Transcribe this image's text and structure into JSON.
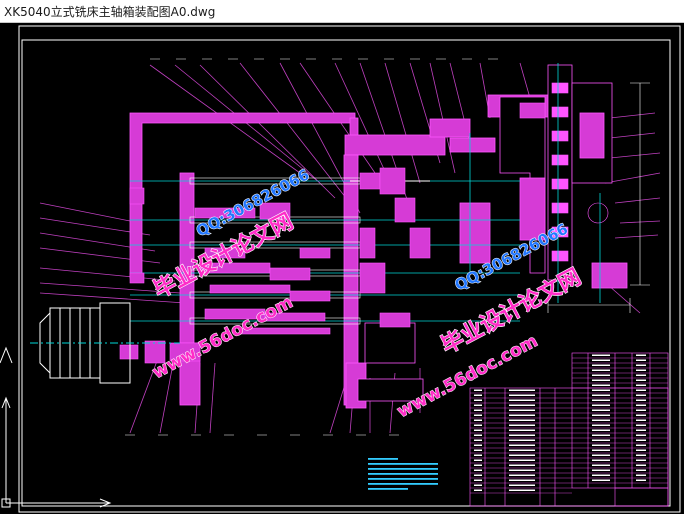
{
  "window": {
    "title": "XK5040立式铣床主轴箱装配图A0.dwg"
  },
  "watermarks": {
    "brand_1": "毕业设计论文网",
    "qq_1": "QQ:306826066",
    "site_1": "www.56doc.com",
    "site_2": "www.56doc.com",
    "brand_2": "毕业设计论文网",
    "qq_2": "QQ:306826066"
  },
  "colors": {
    "background": "#000000",
    "frame": "#ffffff",
    "part_fill": "#d63bd6",
    "part_line": "#ff55ff",
    "center_line": "#00d7d7",
    "leader_line": "#d040d0",
    "table_line": "#ff55ff",
    "table_text": "#ffffff",
    "note_text": "#33ccff",
    "watermark_pink": "#ff2cc8",
    "watermark_blue": "#2277ff",
    "watermark_outline": "#ffffff"
  },
  "icons": {
    "ucs": "ucs-axis-icon"
  }
}
